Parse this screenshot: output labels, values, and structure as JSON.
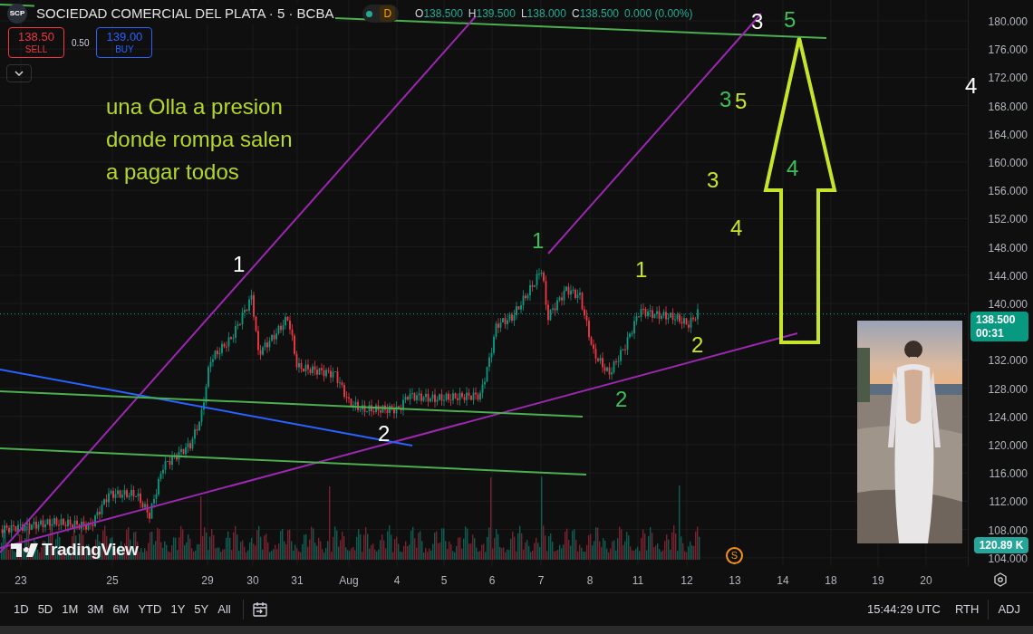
{
  "header": {
    "logo": "SCP",
    "symbol": "SOCIEDAD COMERCIAL DEL PLATA · 5 · BCBA",
    "session_badge": "D",
    "ohlc": [
      {
        "label": "O",
        "value": "138.500"
      },
      {
        "label": "H",
        "value": "139.500"
      },
      {
        "label": "L",
        "value": "138.000"
      },
      {
        "label": "C",
        "value": "138.500"
      }
    ],
    "change": "0.000 (0.00%)"
  },
  "trade": {
    "sell": {
      "price": "138.50",
      "label": "SELL"
    },
    "spread": "0.50",
    "buy": {
      "price": "139.00",
      "label": "BUY"
    }
  },
  "note": [
    "una Olla a presion",
    "donde rompa salen",
    "a pagar todos"
  ],
  "wave_labels": [
    {
      "text": "1",
      "color": "#ffffff"
    },
    {
      "text": "2",
      "color": "#ffffff"
    },
    {
      "text": "3",
      "color": "#ffffff"
    },
    {
      "text": "5",
      "color": "#3fbf5a"
    },
    {
      "text": "3",
      "color": "#3fbf5a"
    },
    {
      "text": "5",
      "color": "#c6e52a"
    },
    {
      "text": "3",
      "color": "#c6e52a"
    },
    {
      "text": "4",
      "color": "#c6e52a"
    },
    {
      "text": "4",
      "color": "#3fbf5a"
    },
    {
      "text": "4",
      "color": "#ffffff"
    },
    {
      "text": "1",
      "color": "#3fbf5a"
    },
    {
      "text": "1",
      "color": "#c6e52a"
    },
    {
      "text": "2",
      "color": "#c6e52a"
    },
    {
      "text": "2",
      "color": "#3fbf5a"
    }
  ],
  "brand": "TradingView",
  "event_marker": "S",
  "price_axis": {
    "ticks": [
      "180.000",
      "176.000",
      "172.000",
      "168.000",
      "164.000",
      "160.000",
      "156.000",
      "152.000",
      "148.000",
      "144.000",
      "140.000",
      "132.000",
      "128.000",
      "124.000",
      "120.000",
      "116.000",
      "112.000",
      "108.000",
      "104.000"
    ],
    "last_price": "138.500",
    "countdown": "00:31",
    "volume": "120.89 K"
  },
  "time_axis": {
    "ticks": [
      "23",
      "25",
      "29",
      "30",
      "31",
      "Aug",
      "4",
      "5",
      "6",
      "7",
      "8",
      "11",
      "12",
      "13",
      "14",
      "18",
      "19",
      "20"
    ]
  },
  "toolbar": {
    "ranges": [
      "1D",
      "5D",
      "1M",
      "3M",
      "6M",
      "YTD",
      "1Y",
      "5Y",
      "All"
    ],
    "time": "15:44:29 UTC",
    "session": "RTH",
    "adjust": "ADJ"
  }
}
